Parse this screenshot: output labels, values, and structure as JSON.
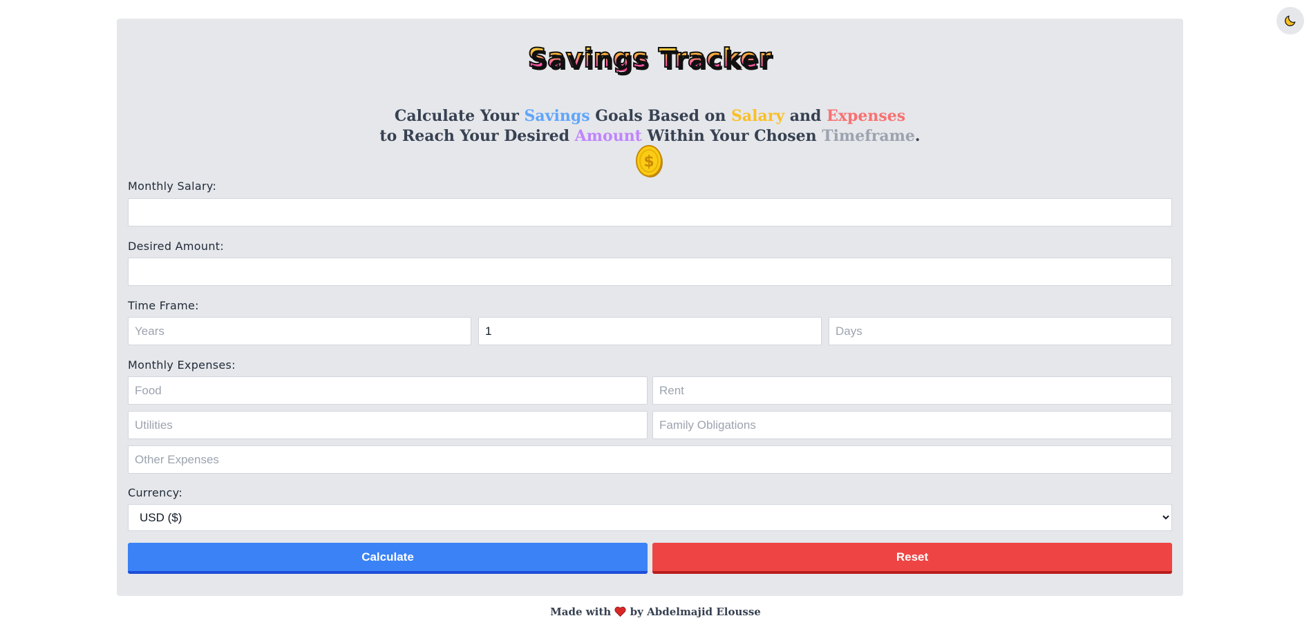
{
  "app": {
    "title": "Savings Tracker",
    "subtitle_line1": [
      {
        "text": "Calculate Your ",
        "color": ""
      },
      {
        "text": "Savings",
        "color": "#60a5fa"
      },
      {
        "text": " Goals Based on ",
        "color": ""
      },
      {
        "text": "Salary",
        "color": "#fbbf24"
      },
      {
        "text": " and ",
        "color": ""
      },
      {
        "text": "Expenses",
        "color": "#f87171"
      }
    ],
    "subtitle_line2": [
      {
        "text": "to Reach Your Desired ",
        "color": ""
      },
      {
        "text": "Amount",
        "color": "#c084fc"
      },
      {
        "text": " Within Your Chosen ",
        "color": ""
      },
      {
        "text": "Timeframe",
        "color": "#9ca3af"
      },
      {
        "text": ".",
        "color": ""
      }
    ],
    "coin_icon": "dollar-coin-icon",
    "theme_toggle_icon": "moon-icon"
  },
  "form": {
    "salary_label": "Monthly Salary:",
    "salary_value": "",
    "desired_label": "Desired Amount:",
    "desired_value": "",
    "timeframe_label": "Time Frame:",
    "years_placeholder": "Years",
    "months_value": "1",
    "days_placeholder": "Days",
    "expenses_label": "Monthly Expenses:",
    "food_placeholder": "Food",
    "rent_placeholder": "Rent",
    "utilities_placeholder": "Utilities",
    "family_placeholder": "Family Obligations",
    "other_placeholder": "Other Expenses",
    "currency_label": "Currency:",
    "currency_selected": "USD ($)"
  },
  "buttons": {
    "calculate": "Calculate",
    "reset": "Reset"
  },
  "footer": {
    "prefix": "Made with",
    "suffix": "by Abdelmajid Elousse"
  },
  "colors": {
    "calculate": "#3b82f6",
    "reset": "#ef4444",
    "card_bg": "#e5e7eb"
  }
}
